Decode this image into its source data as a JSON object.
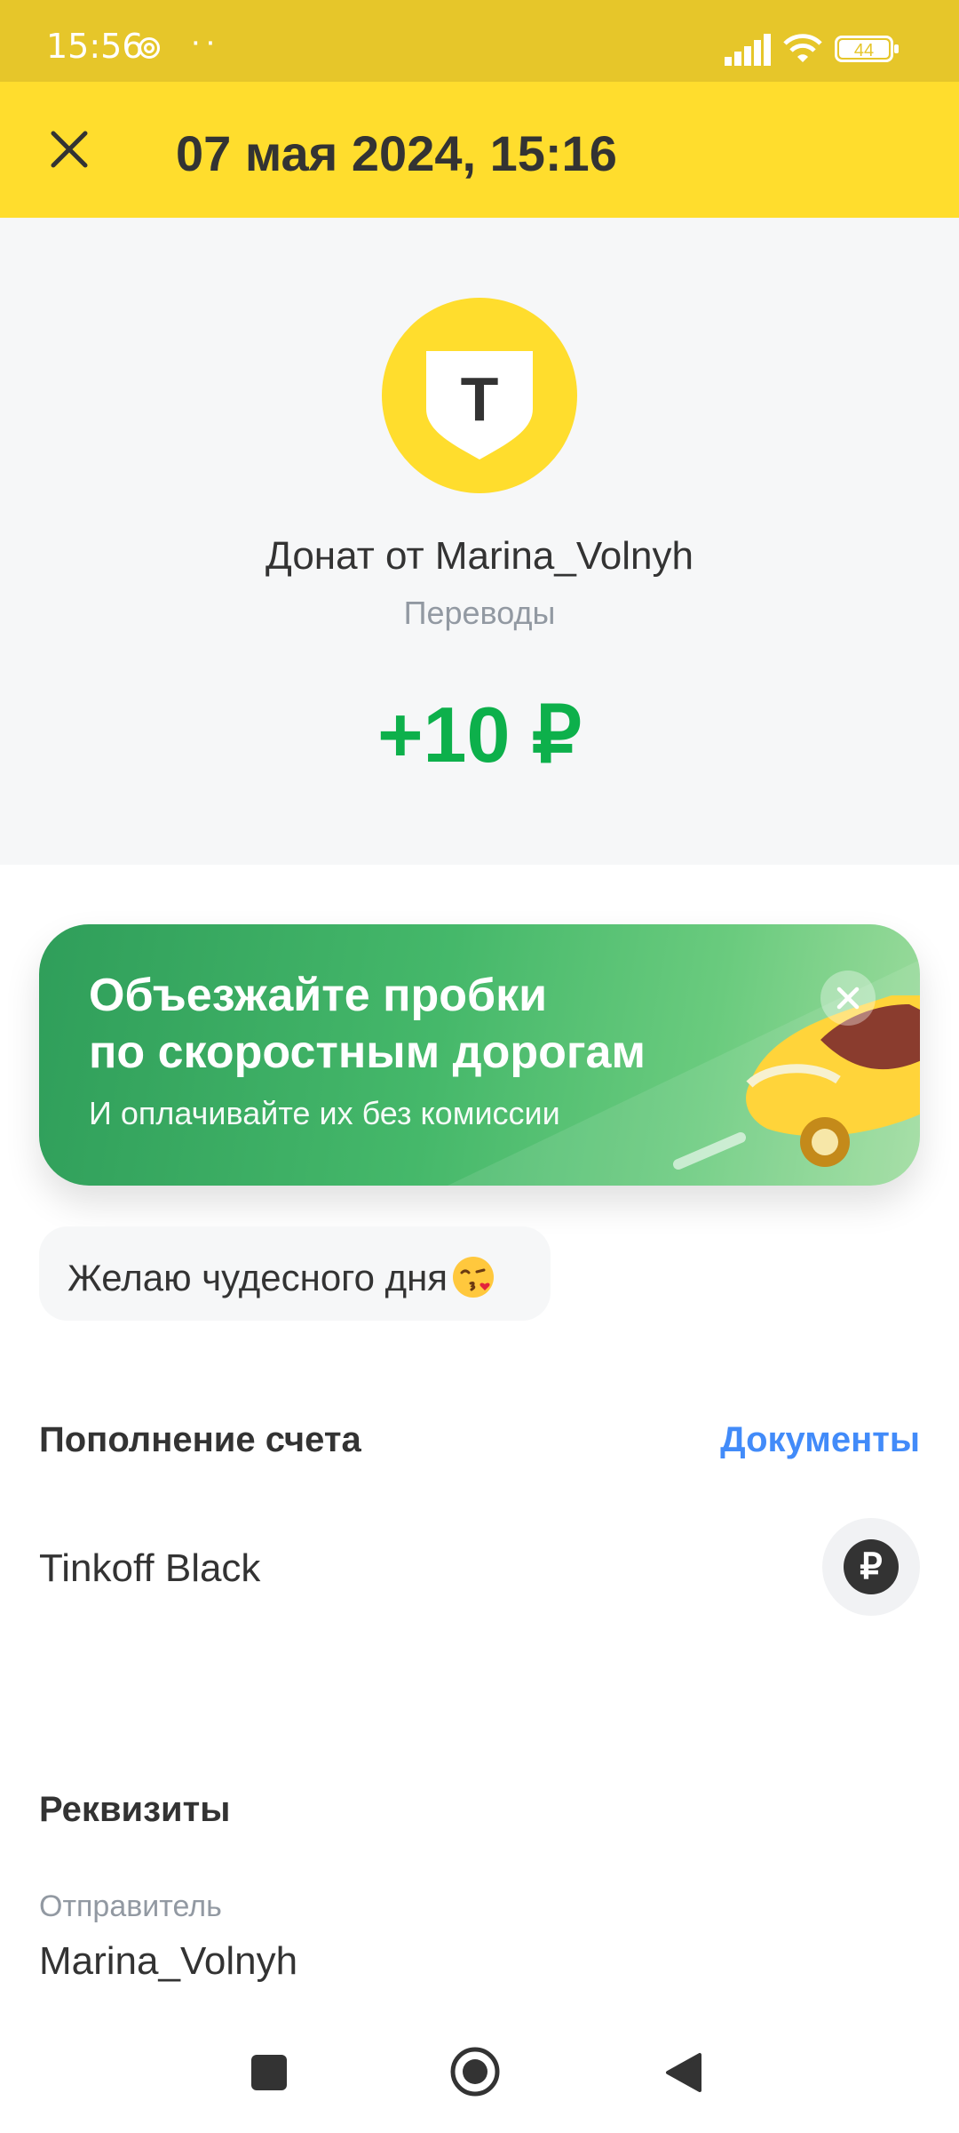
{
  "status_bar": {
    "time": "15:56",
    "dots": "··",
    "battery": "44"
  },
  "header": {
    "title": "07 мая 2024, 15:16",
    "close_icon": "close-icon"
  },
  "transaction": {
    "logo_letter": "T",
    "merchant": "Донат от Marina_Volnyh",
    "category": "Переводы",
    "amount": "+10 ₽",
    "amount_color": "#0DB04B"
  },
  "banner": {
    "title_line1": "Объезжайте пробки",
    "title_line2": "по скоростным дорогам",
    "subtitle": "И оплачивайте их без комиссии",
    "close_icon": "close-icon",
    "image": "yellow-car"
  },
  "message": {
    "text": "Желаю чудесного дня",
    "emoji": "kiss-emoji"
  },
  "account_section": {
    "title": "Пополнение счета",
    "documents_link": "Документы",
    "account_name": "Tinkoff Black",
    "currency_icon": "ruble-icon",
    "currency_symbol": "₽"
  },
  "details_section": {
    "title": "Реквизиты",
    "sender_label": "Отправитель",
    "sender_value": "Marina_Volnyh"
  },
  "colors": {
    "brand_yellow": "#FFDD2D",
    "status_bar": "#E6C62A",
    "link_blue": "#428BF9",
    "banner_green": "#45B86A"
  }
}
